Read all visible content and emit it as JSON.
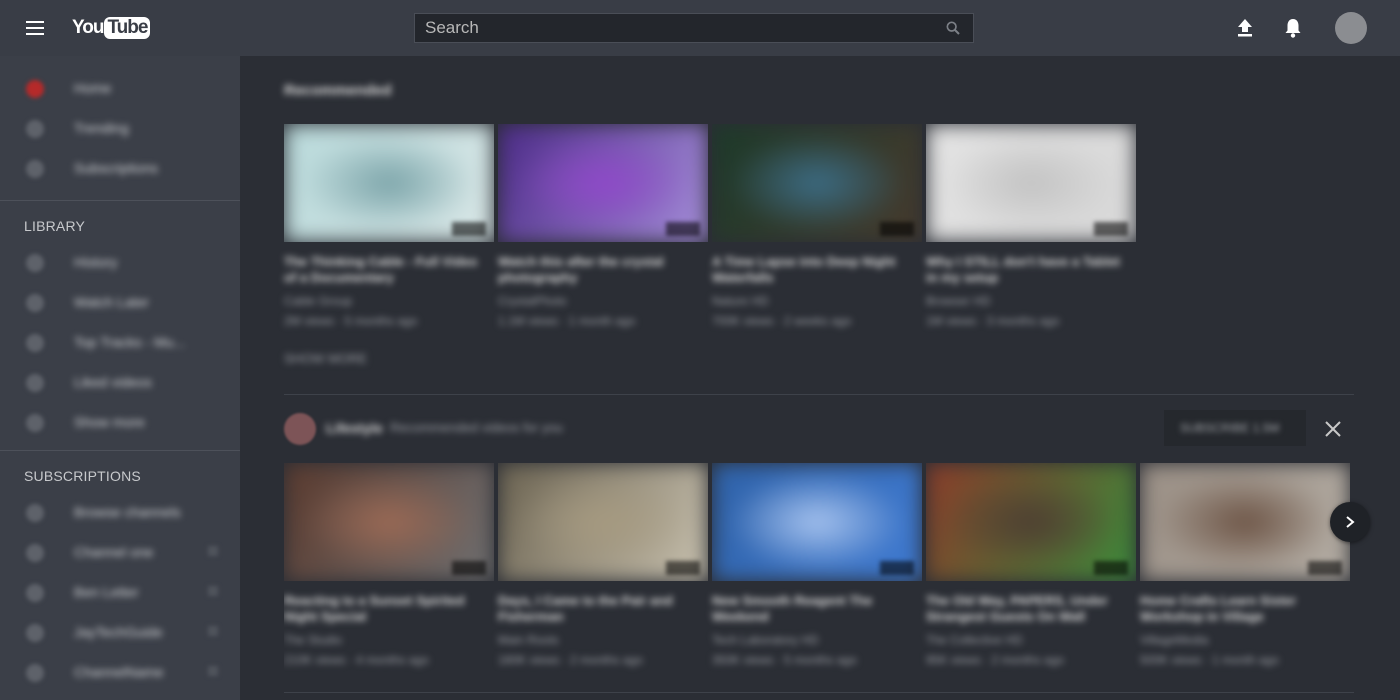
{
  "header": {
    "logo": {
      "you": "You",
      "tube": "Tube"
    },
    "search": {
      "placeholder": "Search"
    },
    "icons": {
      "menu": "hamburger-menu-icon",
      "search": "search-icon",
      "upload": "upload-icon",
      "notifications": "bell-icon",
      "account": "avatar"
    }
  },
  "sidebar": {
    "main_items": [
      {
        "label": "Home",
        "icon": "home-icon",
        "icon_color": "#b52a2a"
      },
      {
        "label": "Trending",
        "icon": "trending-icon"
      },
      {
        "label": "Subscriptions",
        "icon": "subscriptions-icon"
      }
    ],
    "library_heading": "LIBRARY",
    "library_items": [
      {
        "label": "History",
        "icon": "history-icon"
      },
      {
        "label": "Watch Later",
        "icon": "watch-later-icon"
      },
      {
        "label": "Top Tracks - Mu...",
        "icon": "playlist-icon"
      },
      {
        "label": "Liked videos",
        "icon": "playlist-icon"
      },
      {
        "label": "Show more",
        "icon": "chevron-down-icon"
      }
    ],
    "subscriptions_heading": "SUBSCRIPTIONS",
    "subscription_items": [
      {
        "label": "Browse channels"
      },
      {
        "label": "Channel one"
      },
      {
        "label": "Ben Letter"
      },
      {
        "label": "JayTechGuide"
      },
      {
        "label": "ChannelName"
      }
    ]
  },
  "main": {
    "recommended_title": "Recommended",
    "recommended_videos": [
      {
        "title": "The Thinking Cable - Full Video of a Documentary",
        "channel": "Cable Group",
        "meta": "2M views · 5 months ago",
        "colors": [
          "#b9dadb",
          "#7aa3a8",
          "#d8e6e6"
        ]
      },
      {
        "title": "Watch this after the crystal photography",
        "channel": "CrystalPhoto",
        "meta": "1.1M views · 1 month ago",
        "colors": [
          "#4b2a86",
          "#8f48c9",
          "#a58ed9"
        ]
      },
      {
        "title": "A Time Lapse into Deep Night Waterfalls",
        "channel": "Nature HD",
        "meta": "700K views · 2 weeks ago",
        "colors": [
          "#1c3a2a",
          "#3c6d86",
          "#463a2d"
        ]
      },
      {
        "title": "Why I STILL don't have a Tablet in my setup",
        "channel": "Browser HD",
        "meta": "1M views · 3 months ago",
        "colors": [
          "#e4e4e4",
          "#c2c2c2",
          "#d7d7d7"
        ]
      }
    ],
    "show_more": "SHOW MORE",
    "channel_shelf": {
      "name": "Lifestyle",
      "subtitle": "Recommended videos for you",
      "subscribe_label": "SUBSCRIBE 1.5M",
      "videos": [
        {
          "title": "Reacting to a Sunset Spirited Night Special",
          "channel": "The Studio",
          "meta": "210K views · 4 months ago",
          "colors": [
            "#5a3a2e",
            "#9c6a55",
            "#6f6f70"
          ]
        },
        {
          "title": "Days, I Came to the Pair and Fisherman",
          "channel": "Main Roots",
          "meta": "180K views · 2 months ago",
          "colors": [
            "#6a6250",
            "#a69a80",
            "#c9c2b0"
          ]
        },
        {
          "title": "New Smooth Reagent The Weekend",
          "channel": "Tech Laboratory HD",
          "meta": "350K views · 5 months ago",
          "colors": [
            "#2f62a8",
            "#a8c4ef",
            "#3f7ad1"
          ]
        },
        {
          "title": "The Old Way, PAPERS, Under Strangest Guests On Wall",
          "channel": "The Collective HD",
          "meta": "95K views · 2 months ago",
          "colors": [
            "#8a3b2a",
            "#4d3e32",
            "#3a8a3a"
          ]
        },
        {
          "title": "Home Crafts Learn Sister Workshop in Village",
          "channel": "VillageMedia",
          "meta": "500K views · 1 month ago",
          "colors": [
            "#9a8f85",
            "#6c5344",
            "#b3aca3"
          ]
        }
      ]
    }
  }
}
